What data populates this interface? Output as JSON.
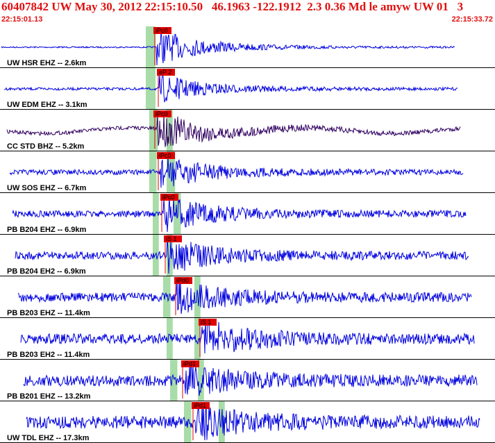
{
  "header": {
    "title": "60407842 UW May 30, 2012 22:15:10.50   46.1963 -122.1912  2.3 0.36 Md le amyw UW 01   3",
    "start_time": "22:15:01.13",
    "end_time": "22:15:33.72"
  },
  "colors": {
    "trace": "#0000e0",
    "trace_dark": "#300060",
    "pick": "#e00000",
    "window": "#a8dca8",
    "title": "#e01010"
  },
  "panels": [
    {
      "label": "UW HSR EHZ -- 2.6km",
      "pick": "iPc0",
      "color": "trace",
      "windows": [
        {
          "t": 4.2,
          "w": 0.8
        }
      ],
      "onset": 4.5,
      "end": 0.68,
      "amp": 0.85
    },
    {
      "label": "UW EDM EHZ -- 3.1km",
      "pick": "eP 2",
      "color": "trace",
      "windows": [
        {
          "t": 4.2,
          "w": 0.8
        }
      ],
      "onset": 4.6,
      "end": 0.68,
      "amp": 0.65
    },
    {
      "label": "CC STD BHZ -- 5.2km",
      "pick": "iPc0",
      "color": "trace_dark",
      "windows": [
        {
          "t": 4.3,
          "w": 0.7
        },
        {
          "t": 4.8,
          "w": 0.5
        }
      ],
      "onset": 4.5,
      "end": 0.68,
      "amp": 0.9
    },
    {
      "label": "UW SOS EHZ -- 6.7km",
      "pick": "iPc0",
      "color": "trace",
      "windows": [
        {
          "t": 4.3,
          "w": 0.6
        },
        {
          "t": 4.8,
          "w": 0.7
        }
      ],
      "onset": 4.6,
      "end": 0.7,
      "amp": 0.75
    },
    {
      "label": "PB B204 EHZ -- 6.9km",
      "pick": "iPc0",
      "color": "trace",
      "windows": [
        {
          "t": 4.4,
          "w": 0.5
        },
        {
          "t": 5.0,
          "w": 0.6
        }
      ],
      "onset": 4.7,
      "end": 0.7,
      "amp": 0.8
    },
    {
      "label": "PB B204 EH2 -- 6.9km",
      "pick": "iS 1",
      "color": "trace",
      "windows": [
        {
          "t": 4.4,
          "w": 0.5
        },
        {
          "t": 4.8,
          "w": 0.5
        }
      ],
      "onset": 4.8,
      "end": 0.7,
      "amp": 0.8
    },
    {
      "label": "PB B203 EHZ -- 11.4km",
      "pick": "iPd0",
      "color": "trace",
      "windows": [
        {
          "t": 4.7,
          "w": 0.6
        },
        {
          "t": 5.6,
          "w": 0.5
        }
      ],
      "onset": 5.1,
      "end": 0.72,
      "amp": 0.75
    },
    {
      "label": "PB B203 EH2 -- 11.4km",
      "pick": "iS 1",
      "color": "trace",
      "windows": [
        {
          "t": 4.8,
          "w": 0.5
        },
        {
          "t": 5.6,
          "w": 0.5
        }
      ],
      "onset": 5.8,
      "end": 0.72,
      "amp": 0.8
    },
    {
      "label": "PB B201 EHZ -- 13.2km",
      "pick": "iPd1",
      "color": "trace",
      "windows": [
        {
          "t": 4.9,
          "w": 0.6
        },
        {
          "t": 5.7,
          "w": 0.5
        }
      ],
      "onset": 5.3,
      "end": 0.72,
      "amp": 0.7
    },
    {
      "label": "UW TDL EHZ -- 17.3km",
      "pick": "iPd1",
      "color": "trace",
      "windows": [
        {
          "t": 5.3,
          "w": 0.6
        },
        {
          "t": 6.3,
          "w": 0.5
        }
      ],
      "onset": 5.6,
      "end": 0.74,
      "amp": 0.7
    }
  ]
}
